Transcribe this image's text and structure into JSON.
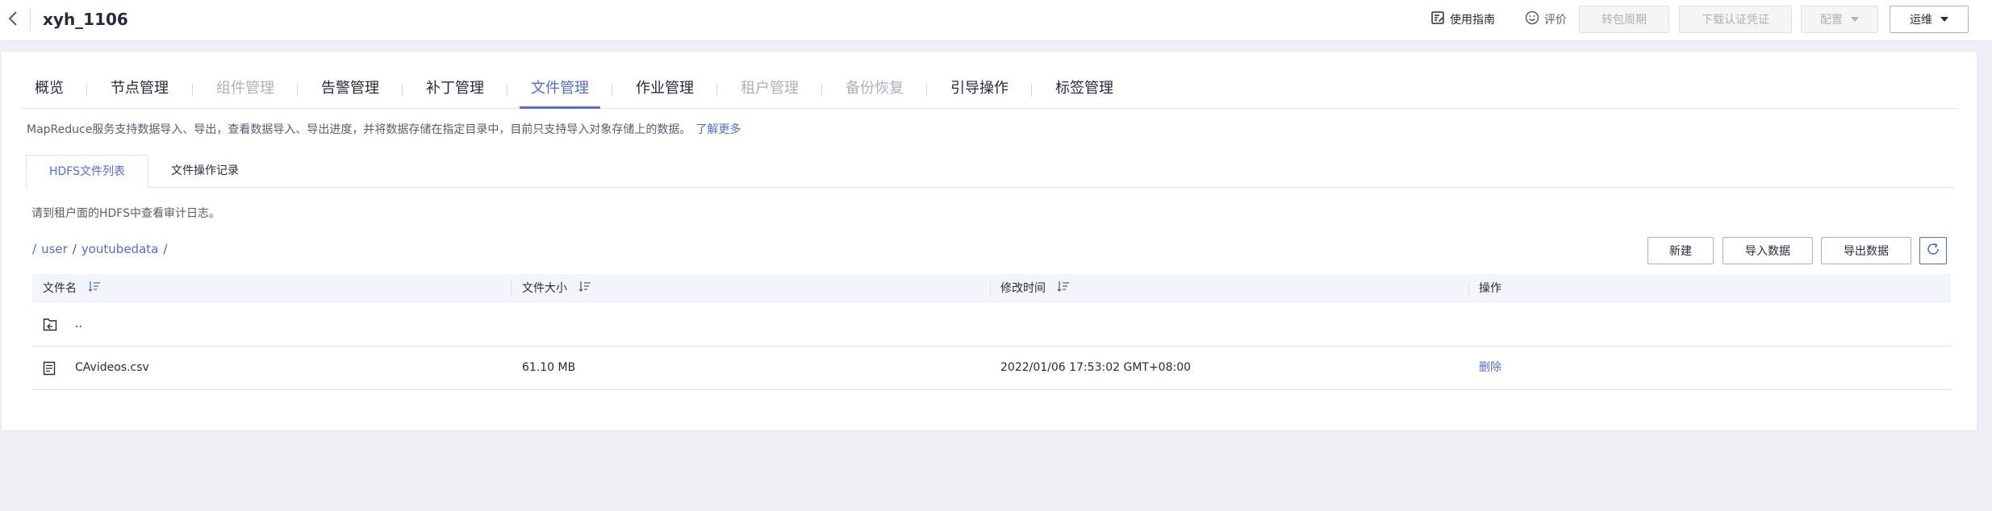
{
  "header": {
    "title": "xyh_1106",
    "guide_label": "使用指南",
    "rate_label": "评价",
    "buttons": {
      "convert_period": "转包周期",
      "download_cert": "下载认证凭证",
      "config": "配置",
      "ops": "运维"
    }
  },
  "tabs": [
    {
      "label": "概览",
      "state": "normal"
    },
    {
      "label": "节点管理",
      "state": "normal"
    },
    {
      "label": "组件管理",
      "state": "disabled"
    },
    {
      "label": "告警管理",
      "state": "normal"
    },
    {
      "label": "补丁管理",
      "state": "normal"
    },
    {
      "label": "文件管理",
      "state": "active"
    },
    {
      "label": "作业管理",
      "state": "normal"
    },
    {
      "label": "租户管理",
      "state": "disabled"
    },
    {
      "label": "备份恢复",
      "state": "disabled"
    },
    {
      "label": "引导操作",
      "state": "normal"
    },
    {
      "label": "标签管理",
      "state": "normal"
    }
  ],
  "description": {
    "text": "MapReduce服务支持数据导入、导出，查看数据导入、导出进度，并将数据存储在指定目录中，目前只支持导入对象存储上的数据。",
    "link": "了解更多"
  },
  "subtabs": {
    "hdfs_list": "HDFS文件列表",
    "op_records": "文件操作记录"
  },
  "audit_note": "请到租户面的HDFS中查看审计日志。",
  "breadcrumb": {
    "items": [
      "user",
      "youtubedata"
    ],
    "separator": "/"
  },
  "actions": {
    "new": "新建",
    "import": "导入数据",
    "export": "导出数据"
  },
  "table": {
    "columns": {
      "name": "文件名",
      "size": "文件大小",
      "modified": "修改时间",
      "ops": "操作"
    },
    "rows": [
      {
        "icon": "folder-up-icon",
        "name": "..",
        "size": "",
        "modified": "",
        "op": ""
      },
      {
        "icon": "file-icon",
        "name": "CAvideos.csv",
        "size": "61.10 MB",
        "modified": "2022/01/06 17:53:02 GMT+08:00",
        "op": "删除"
      }
    ]
  },
  "colors": {
    "accent": "#526ecc",
    "text": "#252b3a",
    "muted": "#adb0b8",
    "background": "#eef0f5",
    "table_header": "#f2f5fc"
  }
}
